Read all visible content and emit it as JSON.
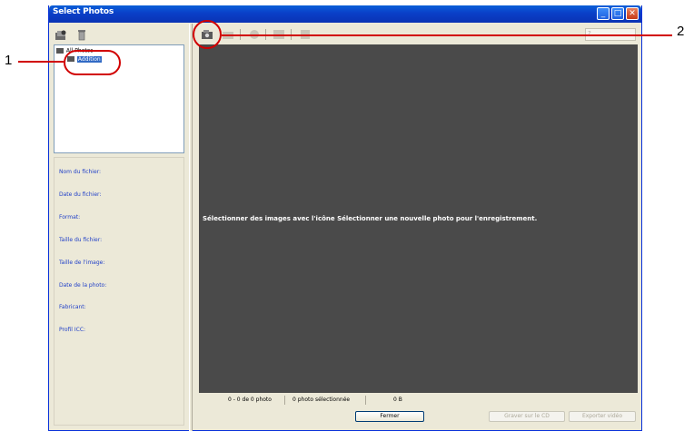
{
  "window": {
    "title": "Select Photos",
    "buttons": {
      "minimize": "_",
      "maximize": "□",
      "close": "✕"
    }
  },
  "left_toolbar": {
    "icons": [
      "add-folder-icon",
      "trash-icon"
    ]
  },
  "tree": {
    "root_label": "All Photos",
    "child_label": "Addition"
  },
  "info_panel": {
    "labels": [
      "Nom du fichier:",
      "Date du fichier:",
      "Format:",
      "Taille du fichier:",
      "Taille de l'image:",
      "Date de la photo:",
      "Fabricant:",
      "Profil ICC:"
    ]
  },
  "right_toolbar": {
    "icons": [
      "select-new-photo-icon",
      "remove-photo-icon",
      "rotate-icon",
      "slideshow-icon",
      "details-icon"
    ],
    "zoom_symbol": "?"
  },
  "viewer": {
    "message": "Sélectionner des images avec l'icône Sélectionner une nouvelle photo pour l'enregistrement."
  },
  "status": {
    "count": "0 - 0 de 0 photo",
    "selected": "0 photo sélectionnée",
    "size": "0 B"
  },
  "buttons": {
    "close": "Fermer",
    "burn_cd": "Graver sur le CD",
    "export_video": "Exporter vidéo"
  },
  "callouts": {
    "one": "1",
    "two": "2"
  },
  "colors": {
    "titlebar": "#0a3fc8",
    "callout": "#d10000",
    "viewer_bg": "#4a4a4a",
    "info_label": "#2140c8"
  }
}
